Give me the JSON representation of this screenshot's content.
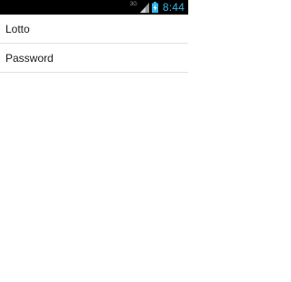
{
  "status_bar": {
    "network_type": "3G",
    "time": "8:44",
    "signal_icon": "signal-bars-icon",
    "battery_icon": "battery-charging-icon",
    "clock_color": "#33b5e5"
  },
  "menu": {
    "items": [
      {
        "label": "Lotto"
      },
      {
        "label": "Password"
      }
    ]
  }
}
